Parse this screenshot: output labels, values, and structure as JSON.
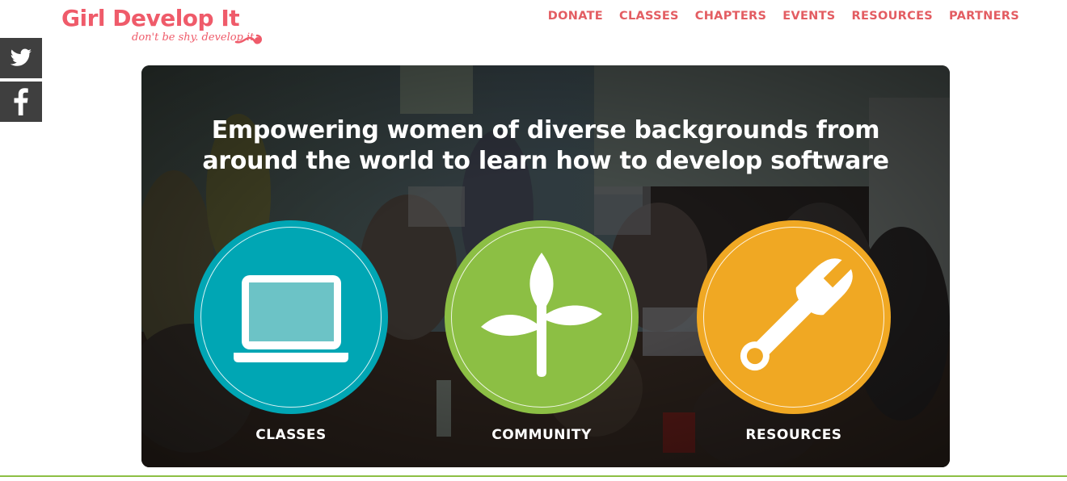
{
  "header": {
    "logo_title": "Girl Develop It",
    "logo_tagline": "don't be shy. develop it.",
    "nav": [
      "DONATE",
      "CLASSES",
      "CHAPTERS",
      "EVENTS",
      "RESOURCES",
      "PARTNERS"
    ]
  },
  "social": {
    "twitter_icon": "twitter-bird-icon",
    "facebook_icon": "facebook-f-icon"
  },
  "hero": {
    "title_line1": "Empowering women of diverse backgrounds from",
    "title_line2": "around the world to learn how to develop software",
    "features": [
      {
        "label": "CLASSES",
        "icon": "laptop-icon",
        "color": "#00a6b4"
      },
      {
        "label": "COMMUNITY",
        "icon": "sprout-icon",
        "color": "#8cbf44"
      },
      {
        "label": "RESOURCES",
        "icon": "wrench-icon",
        "color": "#f0a823"
      }
    ]
  },
  "colors": {
    "brand": "#ef5b6a",
    "nav": "#e35d62",
    "social_bg": "#3f3f3f",
    "footer_rule": "#8cbf44"
  }
}
